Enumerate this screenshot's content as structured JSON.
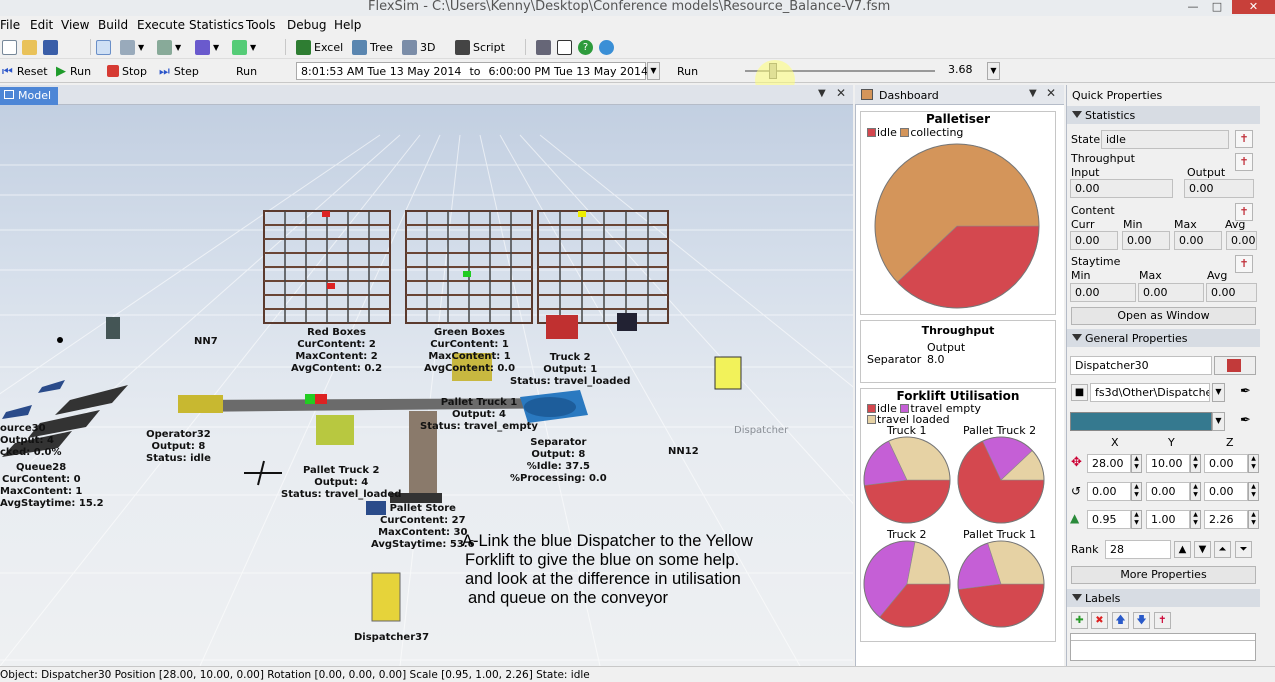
{
  "window": {
    "title": "FlexSim - C:\\Users\\Kenny\\Desktop\\Conference models\\Resource_Balance-V7.fsm",
    "min_icon": "minimize-icon",
    "max_icon": "maximize-icon",
    "close_icon": "close-icon"
  },
  "menu": [
    "File",
    "Edit",
    "View",
    "Build",
    "Execute",
    "Statistics",
    "Tools",
    "Debug",
    "Help"
  ],
  "toolbar1": {
    "excel": "Excel",
    "tree": "Tree",
    "view3d": "3D",
    "script": "Script"
  },
  "toolbar2": {
    "reset": "Reset",
    "run": "Run",
    "stop": "Stop",
    "step": "Step",
    "run_label": "Run",
    "start_time": "8:01:53 AM  Tue 13 May 2014",
    "to": "to",
    "end_time": "6:00:00 PM  Tue 13 May 2014",
    "run_speed_label": "Run",
    "speed": "3.68"
  },
  "model_tab": {
    "label": "Model"
  },
  "scene_labels": {
    "red_boxes": [
      "Red Boxes",
      "CurContent:  2",
      "MaxContent:  2",
      "AvgContent:  0.2"
    ],
    "green_boxes": [
      "Green Boxes",
      "CurContent:  1",
      "MaxContent:  1",
      "AvgContent:  0.0"
    ],
    "truck2_top": [
      "Truck 2",
      "Output: 1",
      "Status: travel_loaded"
    ],
    "pallet_truck1": [
      "Pallet Truck 1",
      "Output: 4",
      "Status: travel_empty"
    ],
    "separator": [
      "Separator",
      "Output: 8",
      "%Idle:  37.5",
      "%Processing: 0.0"
    ],
    "operator32": [
      "Operator32",
      "Output: 8",
      "Status: idle"
    ],
    "pallet_truck2": [
      "Pallet Truck 2",
      "Output: 4",
      "Status: travel_loaded"
    ],
    "pallet_store": [
      "Pallet Store",
      "CurContent:  27",
      "MaxContent:  30",
      "AvgStaytime: 53.6"
    ],
    "queue28": [
      "Queue28",
      "CurContent:  0",
      "MaxContent:  1",
      "AvgStaytime: 15.2"
    ],
    "source30": [
      "ource30",
      "Output: 4",
      "cked: 0.0%"
    ],
    "nn7": "NN7",
    "nn12": "NN12",
    "dispatcher_floor": "Dispatcher",
    "dispatcher37": "Dispatcher37"
  },
  "annotation": [
    "A-Link the blue Dispatcher to the Yellow",
    "Forklift to give the blue on some help.",
    "and look at the difference in utilisation",
    "and queue on the conveyor"
  ],
  "dashboard": {
    "tab": "Dashboard",
    "palletiser": {
      "title": "Palletiser",
      "legend": [
        "idle",
        "collecting"
      ]
    },
    "throughput": {
      "title": "Throughput",
      "column": "Output",
      "row_label": "Separator",
      "row_value": "8.0"
    },
    "forklift": {
      "title": "Forklift Utilisation",
      "legend": [
        "idle",
        "travel empty",
        "travel loaded"
      ],
      "pies": [
        "Truck 1",
        "Pallet Truck 2",
        "Truck 2",
        "Pallet Truck 1"
      ]
    }
  },
  "chart_data": [
    {
      "type": "pie",
      "title": "Palletiser",
      "categories": [
        "idle",
        "collecting"
      ],
      "values": [
        38,
        62
      ],
      "colors": [
        "#d4484f",
        "#d4955a"
      ]
    },
    {
      "type": "pie",
      "title": "Truck 1",
      "categories": [
        "idle",
        "travel empty",
        "travel loaded"
      ],
      "values": [
        48,
        20,
        32
      ],
      "colors": [
        "#d4484f",
        "#c55fd6",
        "#e6d2a4"
      ]
    },
    {
      "type": "pie",
      "title": "Pallet Truck 2",
      "categories": [
        "idle",
        "travel empty",
        "travel loaded"
      ],
      "values": [
        68,
        20,
        12
      ],
      "colors": [
        "#d4484f",
        "#c55fd6",
        "#e6d2a4"
      ]
    },
    {
      "type": "pie",
      "title": "Truck 2",
      "categories": [
        "idle",
        "travel empty",
        "travel loaded"
      ],
      "values": [
        36,
        42,
        22
      ],
      "colors": [
        "#d4484f",
        "#c55fd6",
        "#e6d2a4"
      ]
    },
    {
      "type": "pie",
      "title": "Pallet Truck 1",
      "categories": [
        "idle",
        "travel empty",
        "travel loaded"
      ],
      "values": [
        48,
        22,
        30
      ],
      "colors": [
        "#d4484f",
        "#c55fd6",
        "#e6d2a4"
      ]
    }
  ],
  "quick": {
    "title": "Quick Properties",
    "statistics": "Statistics",
    "state_label": "State",
    "state_value": "idle",
    "throughput": "Throughput",
    "input": "Input",
    "output": "Output",
    "input_value": "0.00",
    "output_value": "0.00",
    "content": "Content",
    "curr": "Curr",
    "min": "Min",
    "max": "Max",
    "avg": "Avg",
    "content_values": [
      "0.00",
      "0.00",
      "0.00",
      "0.00"
    ],
    "staytime": "Staytime",
    "stay_values": [
      "0.00",
      "0.00",
      "0.00"
    ],
    "open_window": "Open as Window",
    "general": "General Properties",
    "name": "Dispatcher30",
    "shape": "fs3d\\Other\\Dispatcher.",
    "color": "#35798f",
    "x": "X",
    "y": "Y",
    "z": "Z",
    "position": [
      "28.00",
      "10.00",
      "0.00"
    ],
    "rotation": [
      "0.00",
      "0.00",
      "0.00"
    ],
    "scale": [
      "0.95",
      "1.00",
      "2.26"
    ],
    "rank_label": "Rank",
    "rank": "28",
    "more": "More Properties",
    "labels": "Labels"
  },
  "status": "Object: Dispatcher30 Position [28.00, 10.00, 0.00]  Rotation [0.00, 0.00, 0.00]  Scale [0.95, 1.00, 2.26]  State: idle"
}
